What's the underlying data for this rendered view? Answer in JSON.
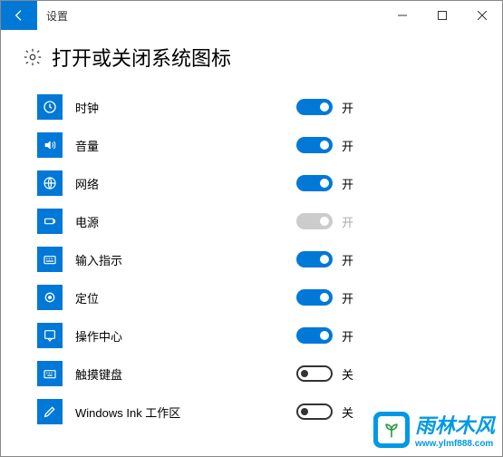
{
  "window": {
    "title": "设置"
  },
  "page": {
    "heading": "打开或关闭系统图标"
  },
  "toggle_labels": {
    "on": "开",
    "off": "关"
  },
  "items": [
    {
      "id": "clock",
      "label": "时钟",
      "state": "on"
    },
    {
      "id": "volume",
      "label": "音量",
      "state": "on"
    },
    {
      "id": "network",
      "label": "网络",
      "state": "on"
    },
    {
      "id": "power",
      "label": "电源",
      "state": "disabled"
    },
    {
      "id": "ime",
      "label": "输入指示",
      "state": "on"
    },
    {
      "id": "location",
      "label": "定位",
      "state": "on"
    },
    {
      "id": "action-center",
      "label": "操作中心",
      "state": "on"
    },
    {
      "id": "touch-keyboard",
      "label": "触摸键盘",
      "state": "off"
    },
    {
      "id": "windows-ink",
      "label": "Windows Ink 工作区",
      "state": "off"
    }
  ],
  "watermark": {
    "text": "雨林木风",
    "url": "www.ylmf888.com"
  }
}
